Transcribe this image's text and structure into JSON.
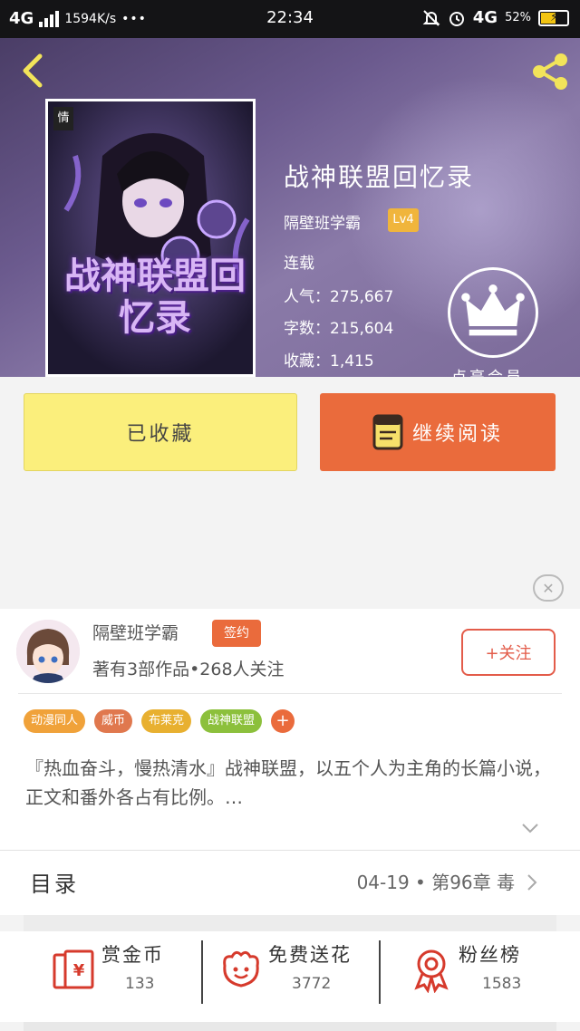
{
  "status_bar": {
    "network": "4G",
    "speed": "1594K/s",
    "dots": "•••",
    "time": "22:34",
    "network_right": "4G",
    "battery": "52%"
  },
  "book": {
    "title": "战神联盟回忆录",
    "author": "隔壁班学霸",
    "level": "Lv4",
    "status": "连载",
    "popularity_line": "人气：275,667",
    "words_line": "字数：215,604",
    "favorites_line": "收藏：1,415",
    "vip_label": "点亮会员",
    "cover_publisher_tag": "情",
    "cover_title_art": "战神联盟回忆录"
  },
  "actions": {
    "favorited_label": "已收藏",
    "continue_label": "继续阅读"
  },
  "author_card": {
    "name": "隔壁班学霸",
    "signed_badge": "签约",
    "works_line": "著有3部作品•268人关注",
    "follow_label": "+关注",
    "tags": [
      {
        "label": "动漫同人",
        "color": "#f0a23a"
      },
      {
        "label": "威币",
        "color": "#e0784e"
      },
      {
        "label": "布莱克",
        "color": "#e8b030"
      },
      {
        "label": "战神联盟",
        "color": "#8cc03c"
      }
    ],
    "tag_add": "+",
    "description": "『热血奋斗，慢热清水』战神联盟，以五个人为主角的长篇小说，正文和番外各占有比例。…"
  },
  "catalog": {
    "label": "目录",
    "latest": "04-19 • 第96章 毒"
  },
  "rewards": {
    "items": [
      {
        "label": "赏金币",
        "count": "133",
        "icon": "coin-envelope-icon"
      },
      {
        "label": "免费送花",
        "count": "3772",
        "icon": "flower-icon"
      },
      {
        "label": "粉丝榜",
        "count": "1583",
        "icon": "medal-icon"
      }
    ]
  },
  "colors": {
    "accent_orange": "#ea6b3c",
    "favorite_yellow": "#fbef7c",
    "level_badge": "#f0b53c"
  }
}
